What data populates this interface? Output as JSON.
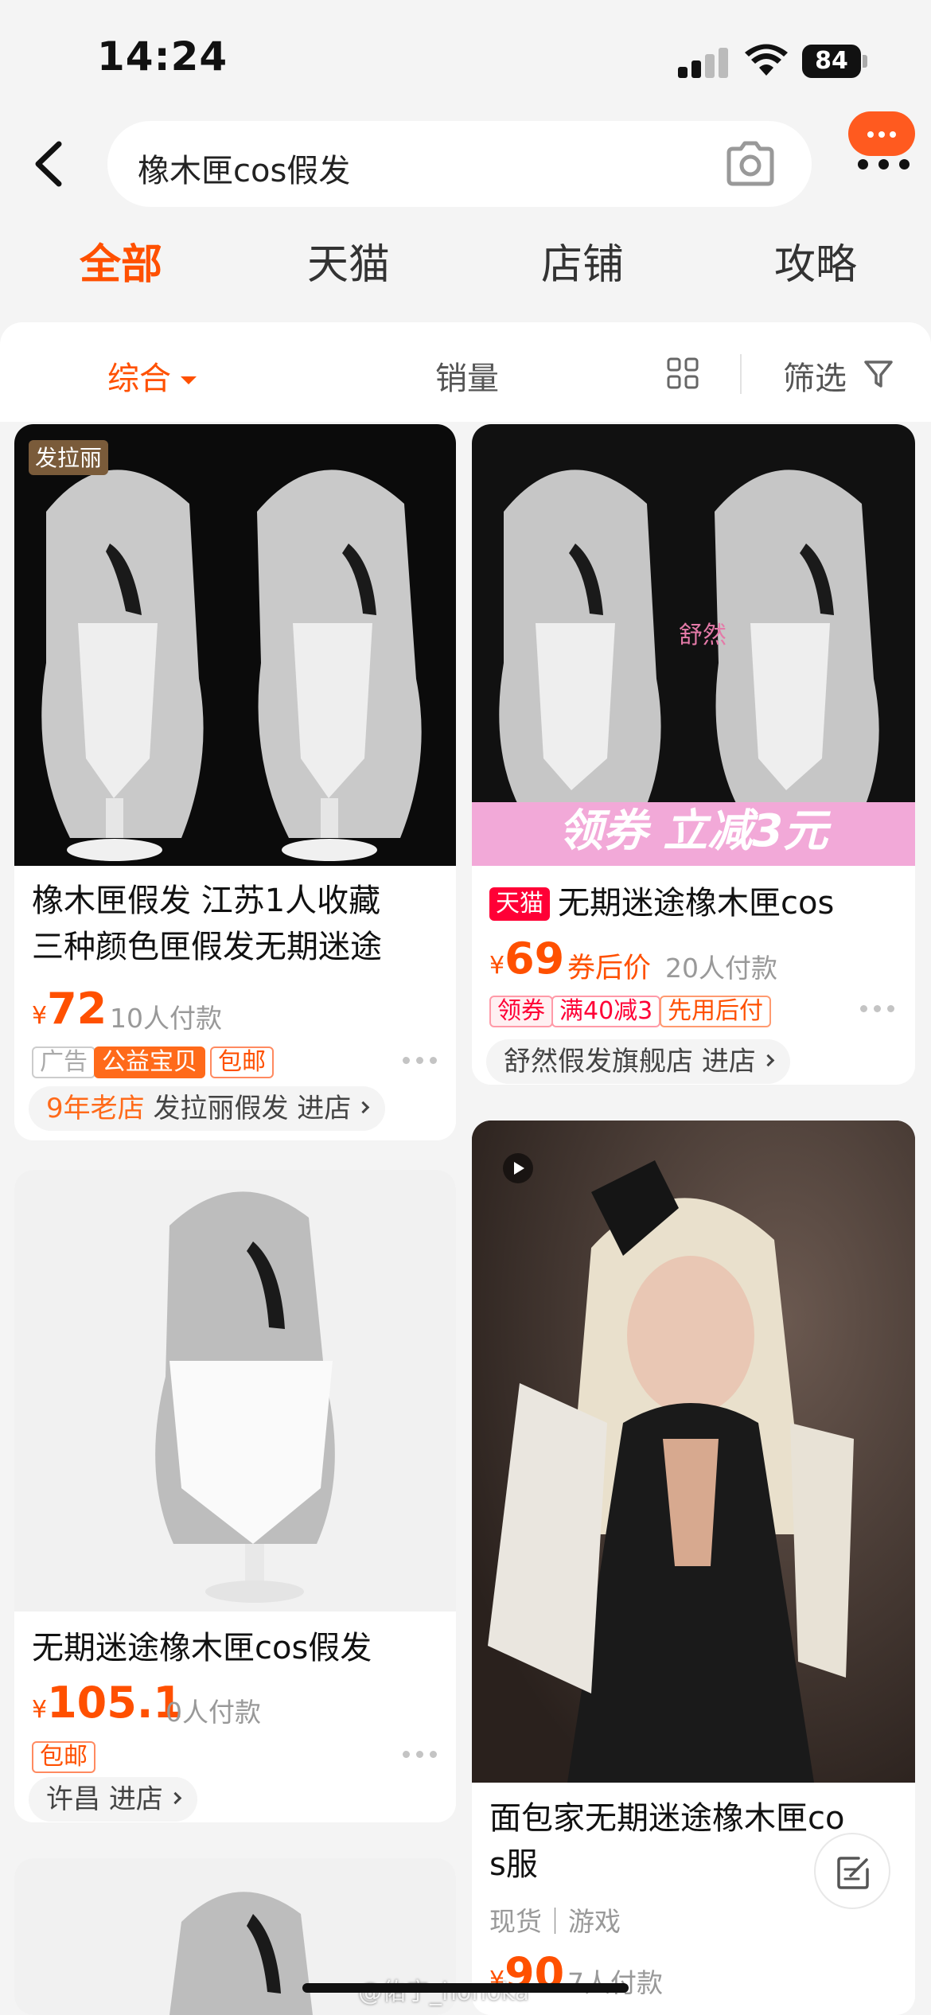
{
  "status_bar": {
    "time": "14:24",
    "battery": "84"
  },
  "search": {
    "query": "橡木匣cos假发"
  },
  "tabs": [
    {
      "label": "全部",
      "active": true
    },
    {
      "label": "天猫"
    },
    {
      "label": "店铺"
    },
    {
      "label": "攻略"
    }
  ],
  "sort_bar": {
    "comprehensive": "综合",
    "sales": "销量",
    "filter": "筛选"
  },
  "products": [
    {
      "title_line1": "橡木匣假发 江苏1人收藏",
      "title_line2": "三种颜色匣假发无期迷途",
      "currency": "¥",
      "price": "72",
      "sold": "10人付款",
      "tags": [
        "广告",
        "公益宝贝",
        "包邮"
      ],
      "shop_age": "9年老店",
      "shop_name": "发拉丽假发",
      "enter_shop": "进店",
      "image_logo": "发拉丽"
    },
    {
      "badge": "天猫",
      "title": "无期迷途橡木匣cos",
      "currency": "¥",
      "price": "69",
      "price_note": "券后价",
      "sold": "20人付款",
      "tags": [
        "领券",
        "满40减3",
        "先用后付"
      ],
      "shop_name": "舒然假发旗舰店",
      "enter_shop": "进店",
      "image_banner": "领券  立减3元",
      "image_logo": "舒然"
    },
    {
      "title": "无期迷途橡木匣cos假发",
      "currency": "¥",
      "price": "105.1",
      "sold": "0人付款",
      "tags": [
        "包邮"
      ],
      "shop_name": "许昌",
      "enter_shop": "进店"
    },
    {
      "title_line1": "面包家无期迷途橡木匣co",
      "title_line2": "s服",
      "subtitle": "现货｜游戏",
      "currency": "¥",
      "price": "90",
      "sold": "7人付款"
    }
  ],
  "watermark": "@佑宁_honoka",
  "colors": {
    "accent": "#ff5000",
    "tmall_red": "#ff0036",
    "pink_banner": "#f2a9d8"
  }
}
